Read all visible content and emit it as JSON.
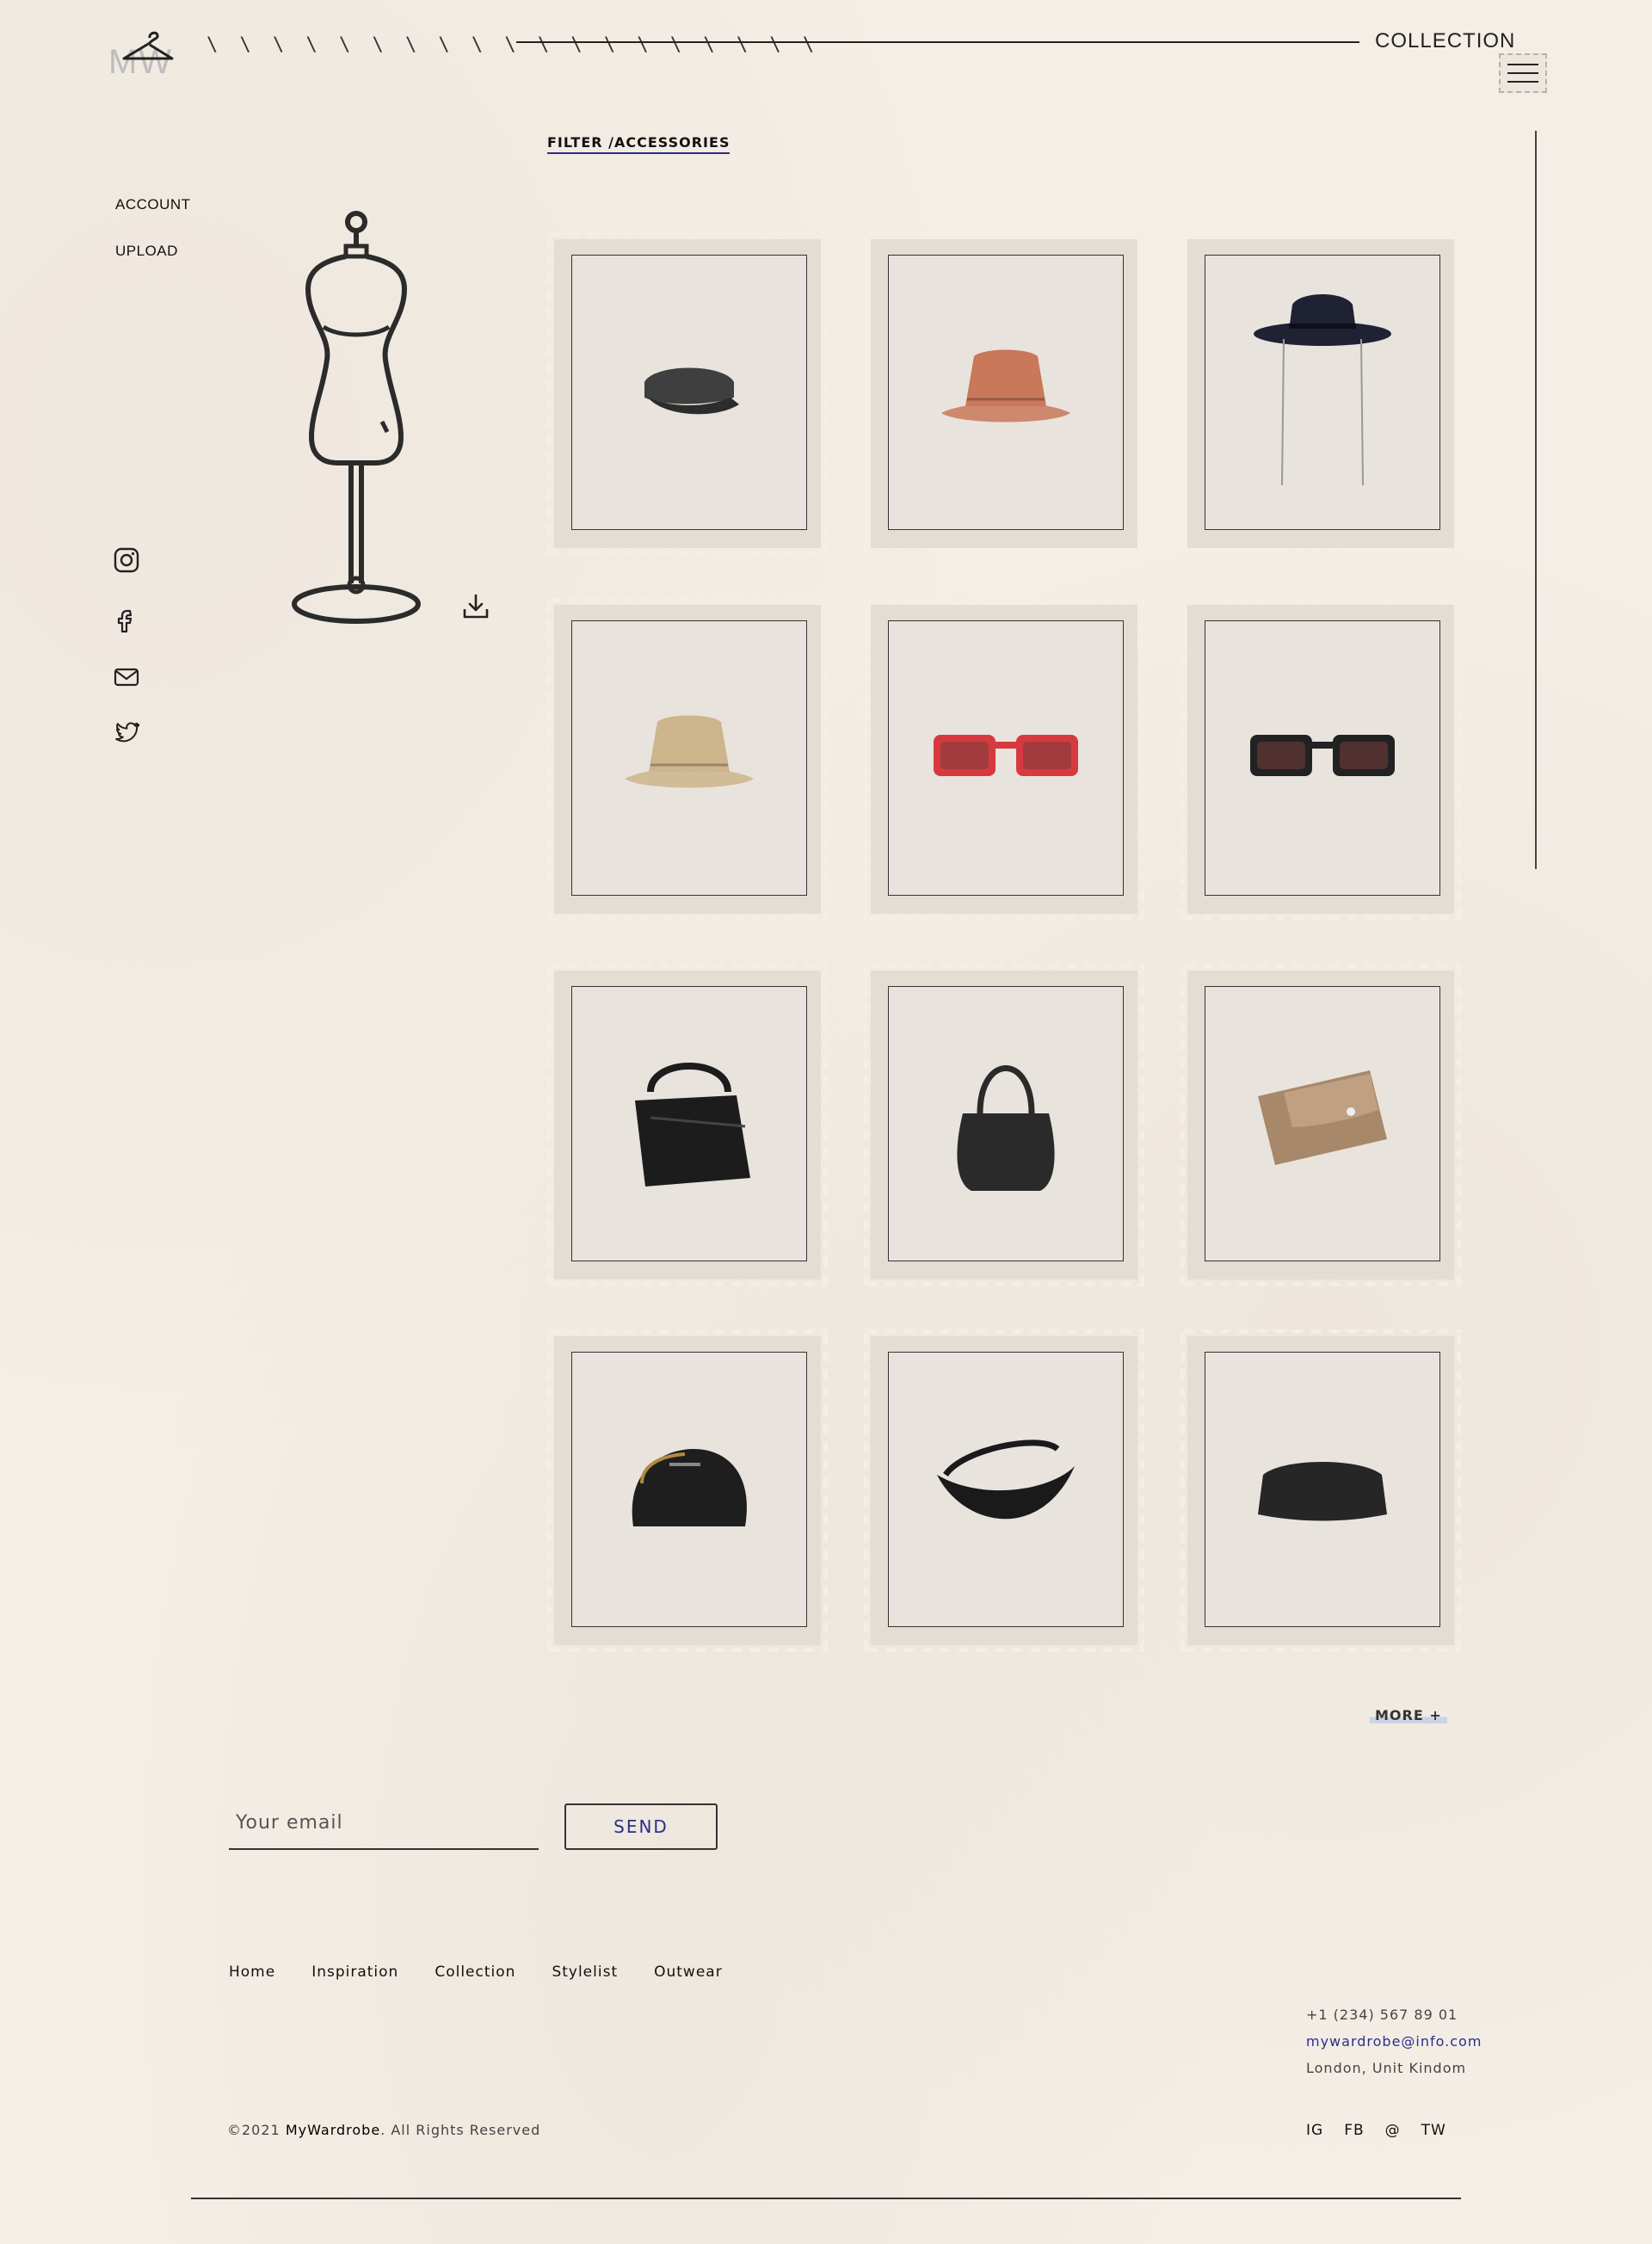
{
  "header": {
    "logo_text": "MW",
    "hatch": "\\ \\ \\ \\ \\ \\ \\ \\ \\ \\ \\ \\ \\ \\ \\ \\ \\ \\ \\",
    "title": "COLLECTION"
  },
  "sidebar": {
    "links": [
      "ACCOUNT",
      "UPLOAD"
    ],
    "social_icons": [
      "instagram-icon",
      "facebook-icon",
      "mail-icon",
      "twitter-icon"
    ]
  },
  "filter": {
    "label": "FILTER /ACCESSORIES"
  },
  "products": [
    {
      "name": "grey-baker-boy-cap",
      "kind": "cap",
      "color": "#3f3f3f"
    },
    {
      "name": "patterned-bucket-hat",
      "kind": "bucket",
      "color": "#c9785a"
    },
    {
      "name": "navy-fedora-hat",
      "kind": "fedora",
      "color": "#1f2233"
    },
    {
      "name": "beige-bucket-hat",
      "kind": "bucket",
      "color": "#cdb58c"
    },
    {
      "name": "red-sunglasses",
      "kind": "glasses",
      "color": "#d63a3f"
    },
    {
      "name": "black-flat-top-sunglasses",
      "kind": "glasses",
      "color": "#222222"
    },
    {
      "name": "black-puzzle-bag",
      "kind": "bag",
      "color": "#1c1c1c"
    },
    {
      "name": "black-hobo-bag",
      "kind": "hobo",
      "color": "#2a2a2a"
    },
    {
      "name": "tan-croc-wallet",
      "kind": "wallet",
      "color": "#a8886a"
    },
    {
      "name": "black-crossbody-bag",
      "kind": "crossbody",
      "color": "#1e1e1e"
    },
    {
      "name": "black-woven-bag",
      "kind": "woven",
      "color": "#1a1a1a"
    },
    {
      "name": "black-pouch-clutch",
      "kind": "pouch",
      "color": "#262626"
    }
  ],
  "more_label": "MORE +",
  "newsletter": {
    "placeholder": "Your email",
    "send_label": "SEND"
  },
  "footer": {
    "nav": [
      "Home",
      "Inspiration",
      "Collection",
      "Stylelist",
      "Outwear"
    ],
    "phone": "+1 (234) 567 89 01",
    "email": "mywardrobe@info.com",
    "location": "London, Unit Kindom",
    "copyright_prefix": "©2021 ",
    "copyright_brand": "MyWardrobe",
    "copyright_suffix": ". All Rights Reserved",
    "social": [
      "IG",
      "FB",
      "@",
      "TW"
    ]
  }
}
